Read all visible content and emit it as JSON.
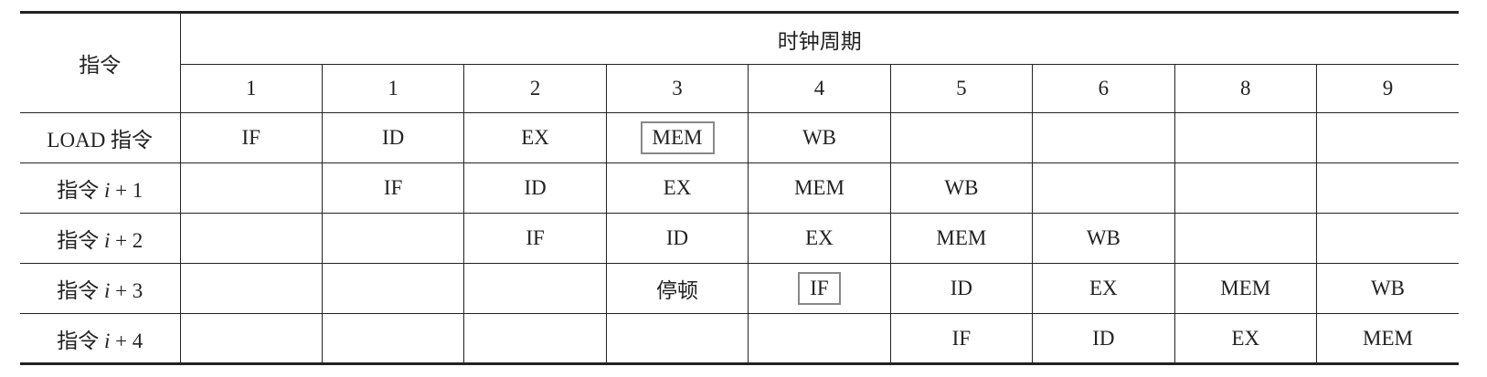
{
  "header": {
    "instruction": "指令",
    "clock_period": "时钟周期",
    "cycles": [
      "1",
      "1",
      "2",
      "3",
      "4",
      "5",
      "6",
      "8",
      "9"
    ]
  },
  "rows": [
    {
      "label": "LOAD 指令",
      "var": "",
      "suffix": "",
      "cells": [
        "IF",
        "ID",
        "EX",
        "MEM",
        "WB",
        "",
        "",
        "",
        ""
      ]
    },
    {
      "label": "指令 ",
      "var": "i",
      "suffix": " + 1",
      "cells": [
        "",
        "IF",
        "ID",
        "EX",
        "MEM",
        "WB",
        "",
        "",
        ""
      ]
    },
    {
      "label": "指令 ",
      "var": "i",
      "suffix": " + 2",
      "cells": [
        "",
        "",
        "IF",
        "ID",
        "EX",
        "MEM",
        "WB",
        "",
        ""
      ]
    },
    {
      "label": "指令 ",
      "var": "i",
      "suffix": " + 3",
      "cells": [
        "",
        "",
        "",
        "停顿",
        "IF",
        "ID",
        "EX",
        "MEM",
        "WB"
      ]
    },
    {
      "label": "指令 ",
      "var": "i",
      "suffix": " + 4",
      "cells": [
        "",
        "",
        "",
        "",
        "",
        "IF",
        "ID",
        "EX",
        "MEM"
      ]
    }
  ],
  "highlighted_cells": [
    {
      "row": 0,
      "col": 3,
      "value": "MEM"
    },
    {
      "row": 3,
      "col": 4,
      "value": "IF"
    }
  ],
  "colors": {
    "rule": "#222222",
    "highlight_box": "#888888"
  }
}
